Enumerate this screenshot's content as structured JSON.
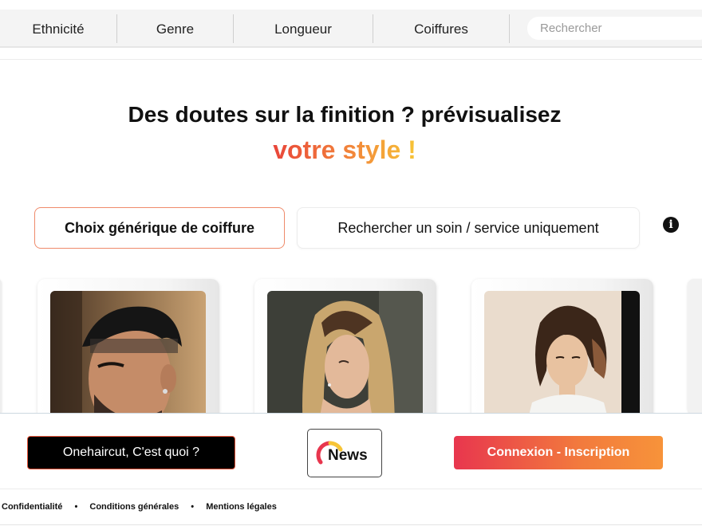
{
  "nav": {
    "items": [
      "Ethnicité",
      "Genre",
      "Longueur",
      "Coiffures"
    ],
    "search_placeholder": "Rechercher"
  },
  "hero": {
    "title": "Des doutes sur la finition ? prévisualisez",
    "accent": "votre style !"
  },
  "choices": {
    "generic": "Choix générique de coiffure",
    "service": "Rechercher un soin / service uniquement",
    "info_icon": "info-icon"
  },
  "bottom": {
    "about_label": "Onehaircut, C'est quoi ?",
    "news_label": "News",
    "login_label": "Connexion - Inscription"
  },
  "footer": {
    "links": [
      "Confidentialité",
      "Conditions générales",
      "Mentions légales"
    ]
  },
  "colors": {
    "accent_start": "#e9453a",
    "accent_end": "#f7c436",
    "login_start": "#e8364e",
    "login_end": "#f7933a"
  }
}
